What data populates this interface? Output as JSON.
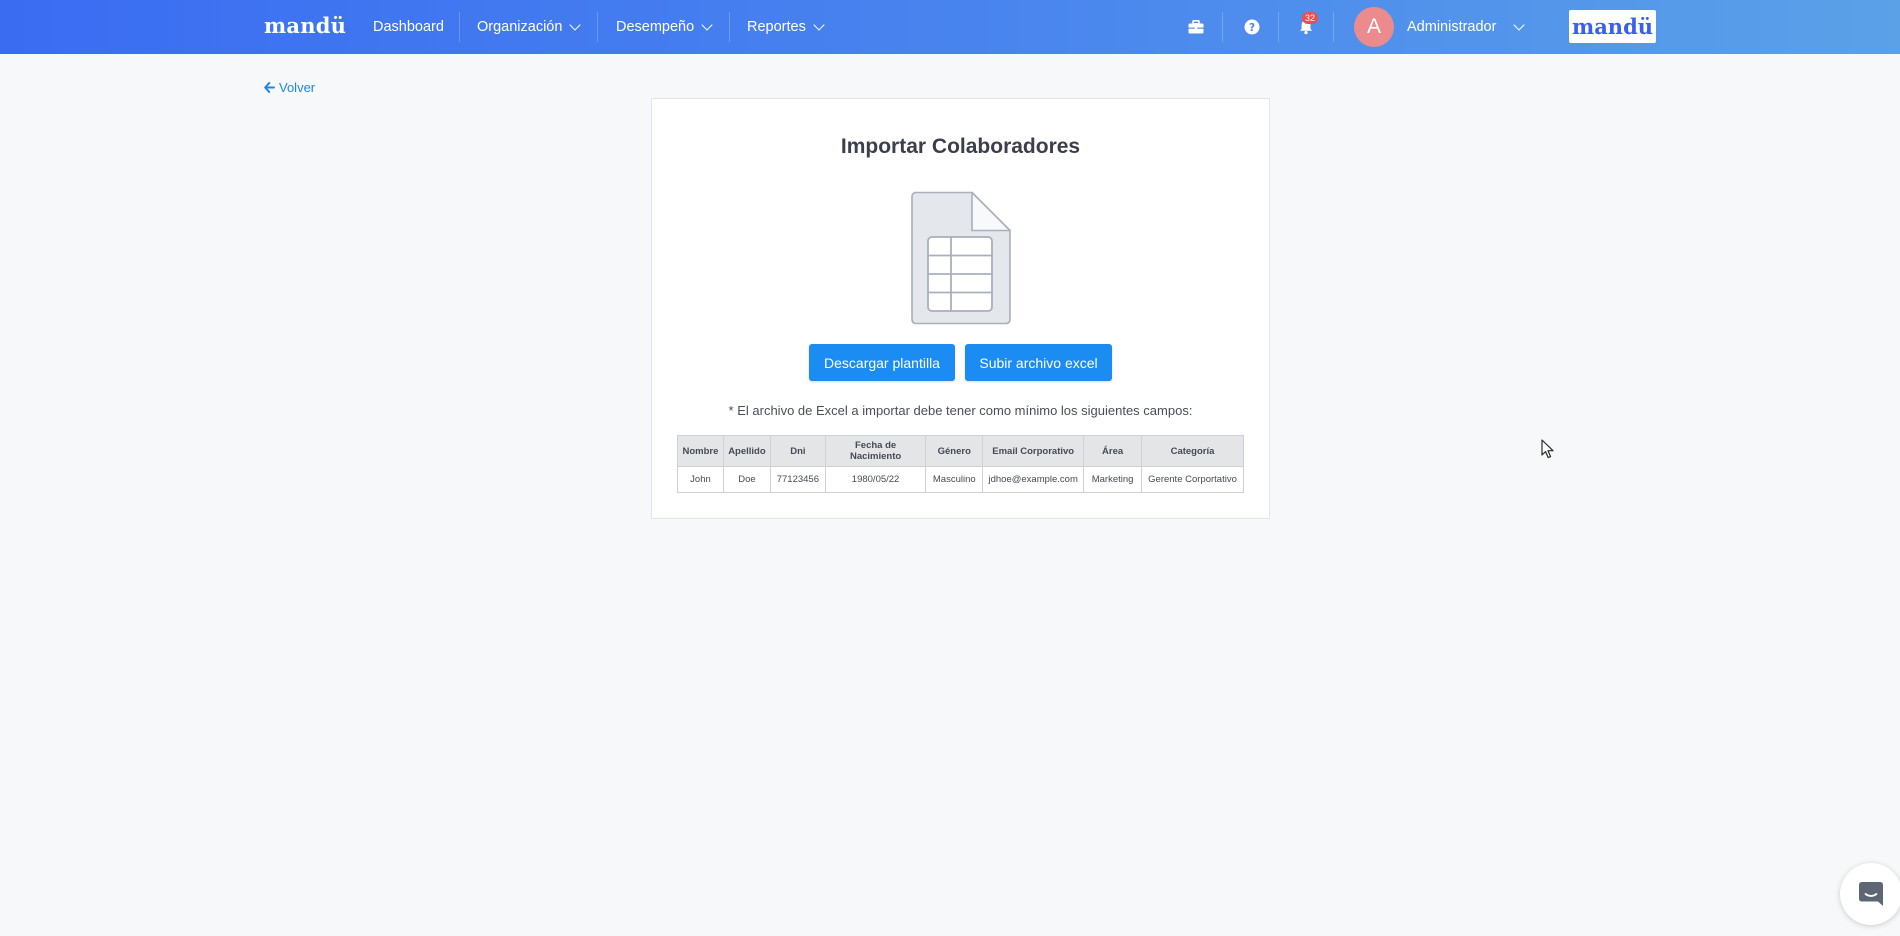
{
  "navbar": {
    "brand": "mandü",
    "items": [
      {
        "label": "Dashboard",
        "has_dropdown": false
      },
      {
        "label": "Organización",
        "has_dropdown": true
      },
      {
        "label": "Desempeño",
        "has_dropdown": true
      },
      {
        "label": "Reportes",
        "has_dropdown": true
      }
    ],
    "icons": [
      "briefcase-icon",
      "help-icon",
      "bell-icon"
    ],
    "notifications_count": "32",
    "user": {
      "avatar_letter": "A",
      "name": "Administrador"
    },
    "client_logo": "mandü",
    "colors": {
      "gradient_start": "#3a6cf2",
      "gradient_end": "#5aa1e8",
      "avatar": "#ec8b8e"
    }
  },
  "back_link": {
    "label": "Volver",
    "icon": "arrow-left-icon"
  },
  "import_card": {
    "title": "Importar Colaboradores",
    "illustration": "spreadsheet-file-icon",
    "download_button": "Descargar plantilla",
    "upload_button": "Subir archivo excel",
    "note": "* El archivo de Excel a importar debe tener como mínimo los siguientes campos:",
    "table": {
      "headers": [
        "Nombre",
        "Apellido",
        "Dni",
        "Fecha de Nacimiento",
        "Género",
        "Email Corporativo",
        "Área",
        "Categoría"
      ],
      "rows": [
        [
          "John",
          "Doe",
          "77123456",
          "1980/05/22",
          "Masculino",
          "jdhoe@example.com",
          "Marketing",
          "Gerente Corportativo"
        ]
      ]
    },
    "accent_color": "#1a8cf2"
  },
  "chat_launcher": {
    "icon": "chat-icon"
  }
}
